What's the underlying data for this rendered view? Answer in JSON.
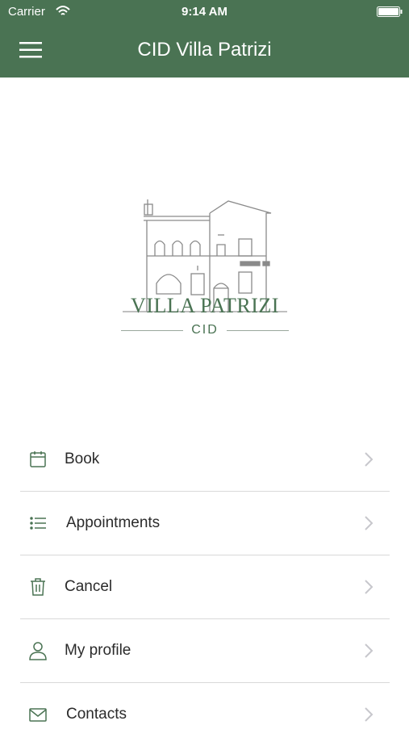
{
  "status_bar": {
    "carrier": "Carrier",
    "time": "9:14 AM"
  },
  "header": {
    "title": "CID Villa Patrizi",
    "menu_icon": "hamburger-menu-icon"
  },
  "logo": {
    "title": "VILLA PATRIZI",
    "subtitle": "CID",
    "icon": "villa-building-illustration"
  },
  "menu": {
    "items": [
      {
        "label": "Book",
        "icon": "calendar-icon"
      },
      {
        "label": "Appointments",
        "icon": "list-icon"
      },
      {
        "label": "Cancel",
        "icon": "trash-icon"
      },
      {
        "label": "My profile",
        "icon": "user-icon"
      },
      {
        "label": "Contacts",
        "icon": "mail-icon"
      }
    ]
  },
  "colors": {
    "brand": "#4a7353",
    "divider": "#d9d9d9",
    "chevron": "#c7c7cc"
  }
}
